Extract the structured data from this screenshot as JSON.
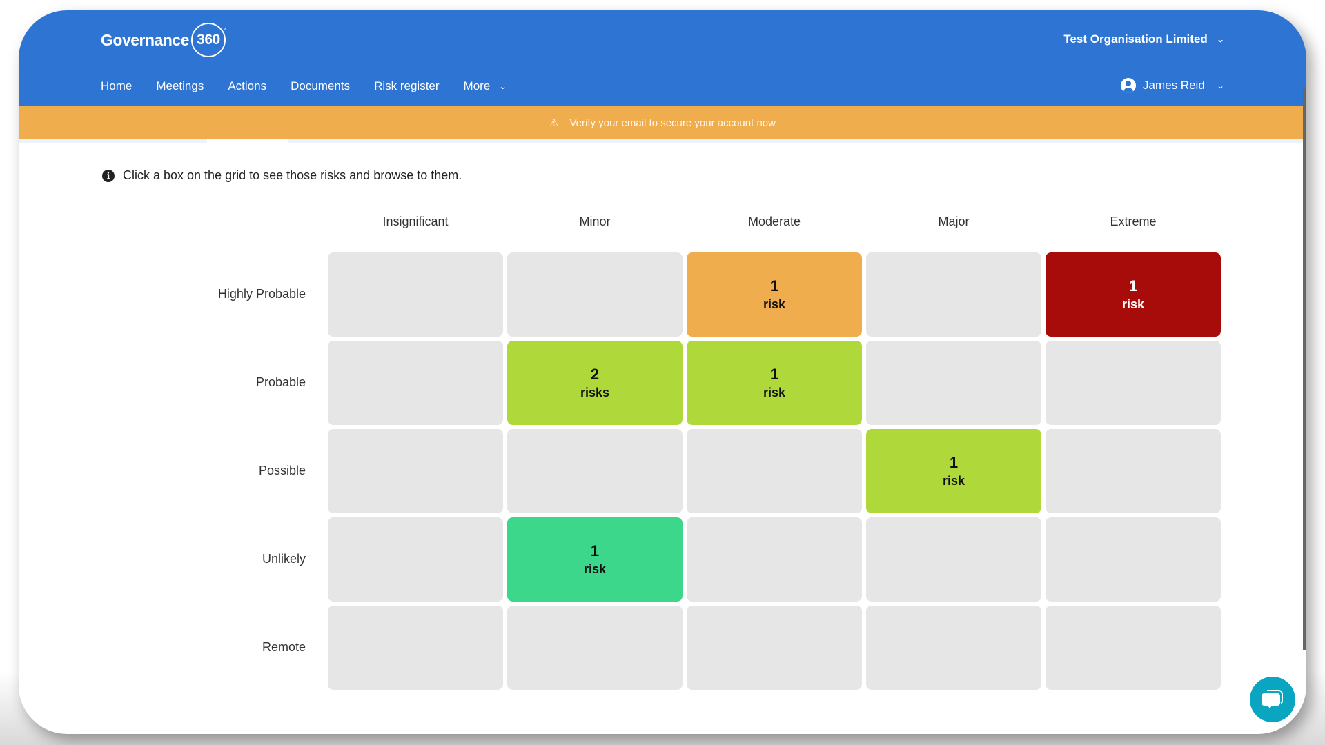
{
  "header": {
    "logo_text": "Governance",
    "logo_badge": "360",
    "logo_degree": "°",
    "organisation": "Test Organisation Limited",
    "user_name": "James Reid",
    "nav": [
      {
        "label": "Home"
      },
      {
        "label": "Meetings"
      },
      {
        "label": "Actions"
      },
      {
        "label": "Documents"
      },
      {
        "label": "Risk register"
      },
      {
        "label": "More",
        "has_dropdown": true
      }
    ]
  },
  "banner": {
    "icon": "warning-icon",
    "text": "Verify your email to secure your account now",
    "color": "#f0ad4e"
  },
  "instructions": {
    "icon": "info-icon",
    "text": "Click a box on the grid to see those risks and browse to them."
  },
  "risk_matrix": {
    "columns": [
      "Insignificant",
      "Minor",
      "Moderate",
      "Major",
      "Extreme"
    ],
    "rows": [
      "Highly Probable",
      "Probable",
      "Possible",
      "Unlikely",
      "Remote"
    ],
    "empty_color": "#e6e6e6",
    "cells": [
      {
        "row": 0,
        "col": 2,
        "count": "1",
        "label": "risk",
        "color": "#f0ad4e",
        "text_color": "#111111"
      },
      {
        "row": 0,
        "col": 4,
        "count": "1",
        "label": "risk",
        "color": "#a80c0a",
        "text_color": "#ffffff"
      },
      {
        "row": 1,
        "col": 1,
        "count": "2",
        "label": "risks",
        "color": "#afd83b",
        "text_color": "#111111"
      },
      {
        "row": 1,
        "col": 2,
        "count": "1",
        "label": "risk",
        "color": "#afd83b",
        "text_color": "#111111"
      },
      {
        "row": 2,
        "col": 3,
        "count": "1",
        "label": "risk",
        "color": "#afd83b",
        "text_color": "#111111"
      },
      {
        "row": 3,
        "col": 1,
        "count": "1",
        "label": "risk",
        "color": "#3dd78c",
        "text_color": "#111111"
      }
    ]
  },
  "chat_button": {
    "icon": "chat-bubble-icon"
  },
  "colors": {
    "brand": "#2d74d3",
    "chat": "#0aa5c0"
  }
}
